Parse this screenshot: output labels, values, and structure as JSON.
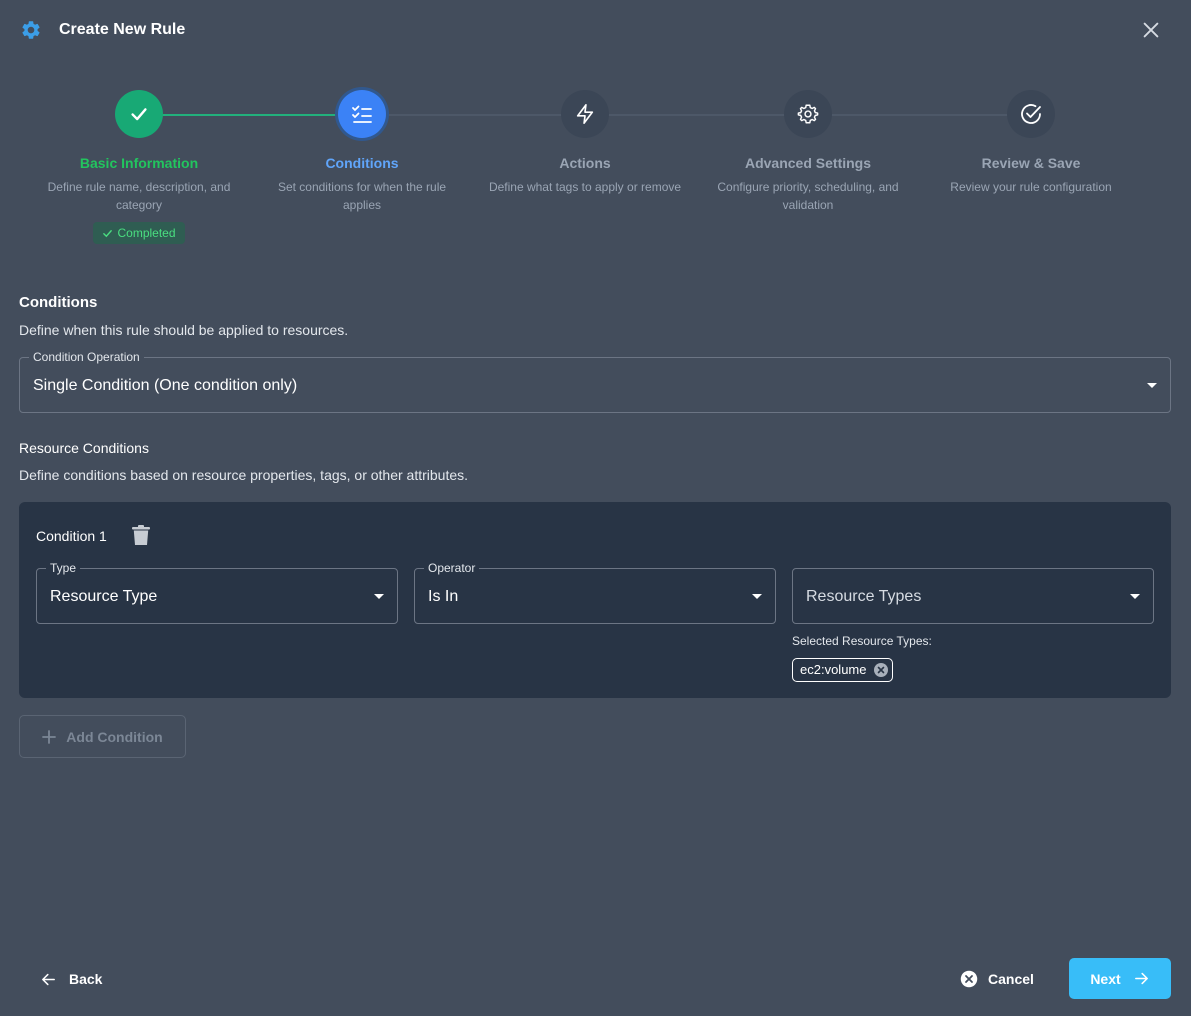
{
  "header": {
    "title": "Create New Rule",
    "icon": "gear-icon",
    "close_icon": "close-icon"
  },
  "colors": {
    "completed": "#18a975",
    "active": "#3b82f6",
    "pending": "#3b4656",
    "next_button": "#38bdf8",
    "background": "#434d5c",
    "card": "#283445"
  },
  "stepper": {
    "steps": [
      {
        "label": "Basic Information",
        "description": "Define rule name, description, and category",
        "status": "completed",
        "badge": "Completed",
        "icon": "check-icon"
      },
      {
        "label": "Conditions",
        "description": "Set conditions for when the rule applies",
        "status": "active",
        "icon": "list-check-icon"
      },
      {
        "label": "Actions",
        "description": "Define what tags to apply or remove",
        "status": "pending",
        "icon": "lightning-icon"
      },
      {
        "label": "Advanced Settings",
        "description": "Configure priority, scheduling, and validation",
        "status": "pending",
        "icon": "gear-icon"
      },
      {
        "label": "Review & Save",
        "description": "Review your rule configuration",
        "status": "pending",
        "icon": "check-circle-icon"
      }
    ]
  },
  "conditions": {
    "title": "Conditions",
    "description": "Define when this rule should be applied to resources.",
    "operation": {
      "label": "Condition Operation",
      "value": "Single Condition (One condition only)"
    },
    "resource": {
      "title": "Resource Conditions",
      "description": "Define conditions based on resource properties, tags, or other attributes."
    },
    "items": [
      {
        "label": "Condition 1",
        "type": {
          "label": "Type",
          "value": "Resource Type"
        },
        "operator": {
          "label": "Operator",
          "value": "Is In"
        },
        "resource_types": {
          "placeholder": "Resource Types",
          "selected_label": "Selected Resource Types:",
          "selected": [
            "ec2:volume"
          ]
        }
      }
    ],
    "add_button": "Add Condition"
  },
  "footer": {
    "back": "Back",
    "cancel": "Cancel",
    "next": "Next"
  }
}
